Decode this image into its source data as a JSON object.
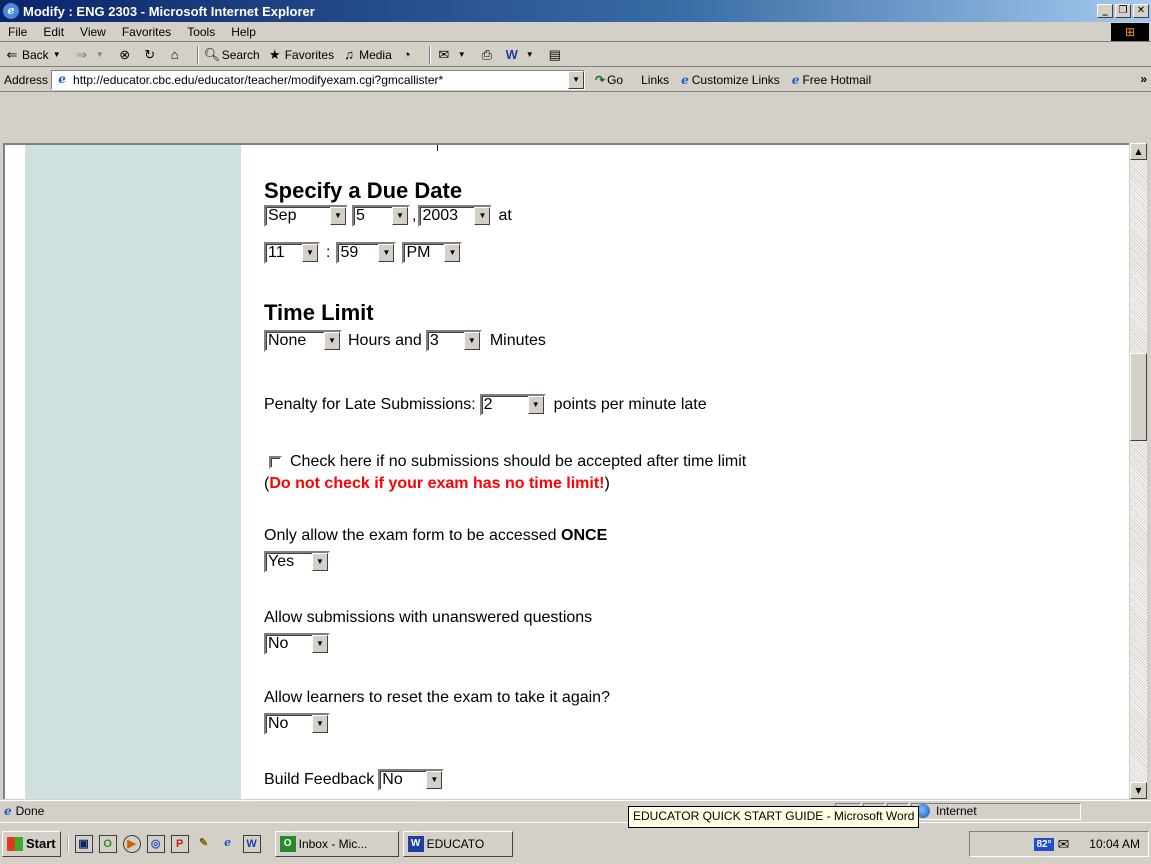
{
  "window": {
    "title": "Modify : ENG 2303 - Microsoft Internet Explorer",
    "buttons": [
      "_",
      "❐",
      "✕"
    ]
  },
  "menu": [
    "File",
    "Edit",
    "View",
    "Favorites",
    "Tools",
    "Help"
  ],
  "toolbar": {
    "back": "Back",
    "search": "Search",
    "favorites": "Favorites",
    "media": "Media"
  },
  "address": {
    "label": "Address",
    "url": "http://educator.cbc.edu/educator/teacher/modifyexam.cgi?gmcallister*",
    "go": "Go",
    "links_label": "Links",
    "link1": "Customize Links",
    "link2": "Free Hotmail"
  },
  "form": {
    "due_date_heading": "Specify a Due Date",
    "month": "Sep",
    "day": "5",
    "comma": ",",
    "year": "2003",
    "at": "at",
    "hour": "11",
    "colon": ":",
    "minute": "59",
    "ampm": "PM",
    "time_limit_heading": "Time Limit",
    "hours_value": "None",
    "hours_and": "Hours and",
    "minutes_value": "3",
    "minutes_label": "Minutes",
    "penalty_label": "Penalty for Late Submissions:",
    "penalty_value": "2",
    "penalty_suffix": "points per minute late",
    "no_accept_label": "Check here if no submissions should be accepted after time limit",
    "warn_open": "(",
    "warn_text": "Do not check if your exam has no time limit!",
    "warn_close": ")",
    "once_label_prefix": "Only allow the exam form to be accessed ",
    "once_label_bold": "ONCE",
    "once_value": "Yes",
    "unanswered_label": "Allow submissions with unanswered questions",
    "unanswered_value": "No",
    "reset_label": "Allow learners to reset the exam to take it again?",
    "reset_value": "No",
    "feedback_label": "Build Feedback",
    "feedback_value": "No"
  },
  "status": {
    "text": "Done",
    "zone": "Internet"
  },
  "taskbar": {
    "start": "Start",
    "task1": "Inbox - Mic...",
    "task2": "EDUCATO",
    "tooltip": "EDUCATOR QUICK START GUIDE - Microsoft Word",
    "weather": "82°",
    "clock": "10:04 AM"
  },
  "colors": {
    "sidebar": "#cfe0e0",
    "warning": "#ff0000",
    "titlebar": "#0a246a"
  }
}
